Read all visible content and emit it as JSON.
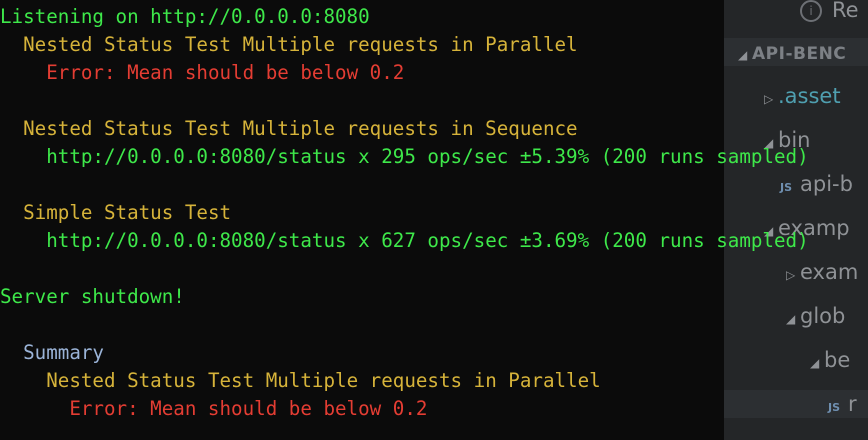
{
  "explorer": {
    "tab_label": "Re",
    "project_header": "API-BENC",
    "items": [
      {
        "label": ".asset",
        "kind": "folder-collapsed"
      },
      {
        "label": "bin",
        "kind": "folder-expanded"
      },
      {
        "label": "api-b",
        "kind": "js-file",
        "badge": "JS"
      },
      {
        "label": "examp",
        "kind": "folder-expanded"
      },
      {
        "label": "exam",
        "kind": "folder-collapsed"
      },
      {
        "label": "glob",
        "kind": "folder-expanded"
      },
      {
        "label": "be",
        "kind": "folder-expanded"
      },
      {
        "label": "r",
        "kind": "js-file",
        "badge": "JS"
      }
    ]
  },
  "terminal": {
    "lines": [
      {
        "text": "Listening on http://0.0.0.0:8080",
        "color": "#3ee84a",
        "indent": 0
      },
      {
        "text": "Nested Status Test Multiple requests in Parallel",
        "color": "#d6b33a",
        "indent": 2
      },
      {
        "text": "Error: Mean should be below 0.2",
        "color": "#e43d33",
        "indent": 4
      },
      {
        "text": "",
        "color": "#3ee84a",
        "indent": 0
      },
      {
        "text": "Nested Status Test Multiple requests in Sequence",
        "color": "#d6b33a",
        "indent": 2
      },
      {
        "text": "http://0.0.0.0:8080/status x 295 ops/sec ±5.39% (200 runs sampled)",
        "color": "#3ee84a",
        "indent": 4
      },
      {
        "text": "",
        "color": "#3ee84a",
        "indent": 0
      },
      {
        "text": "Simple Status Test",
        "color": "#d6b33a",
        "indent": 2
      },
      {
        "text": "http://0.0.0.0:8080/status x 627 ops/sec ±3.69% (200 runs sampled)",
        "color": "#3ee84a",
        "indent": 4
      },
      {
        "text": "",
        "color": "#3ee84a",
        "indent": 0
      },
      {
        "text": "Server shutdown!",
        "color": "#3ee84a",
        "indent": 0
      },
      {
        "text": "",
        "color": "#3ee84a",
        "indent": 0
      },
      {
        "text": "Summary",
        "color": "#9bb4d8",
        "indent": 2
      },
      {
        "text": "Nested Status Test Multiple requests in Parallel",
        "color": "#d6b33a",
        "indent": 4
      },
      {
        "text": "Error: Mean should be below 0.2",
        "color": "#e43d33",
        "indent": 6
      }
    ]
  }
}
